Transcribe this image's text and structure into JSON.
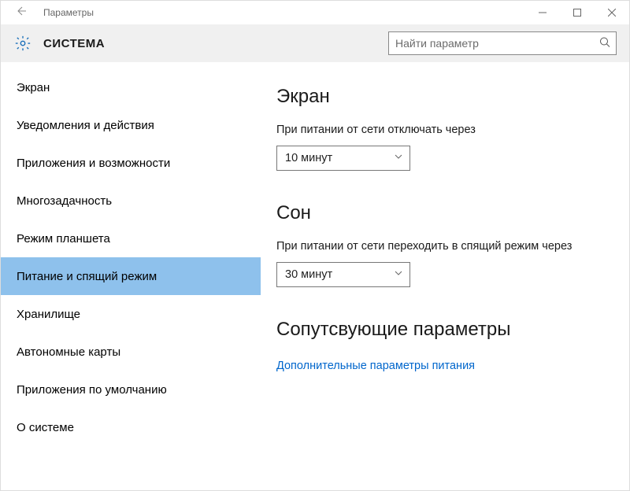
{
  "window": {
    "title": "Параметры"
  },
  "header": {
    "category": "СИСТЕМА",
    "search_placeholder": "Найти параметр"
  },
  "sidebar": {
    "items": [
      {
        "label": "Экран"
      },
      {
        "label": "Уведомления и действия"
      },
      {
        "label": "Приложения и возможности"
      },
      {
        "label": "Многозадачность"
      },
      {
        "label": "Режим планшета"
      },
      {
        "label": "Питание и спящий режим"
      },
      {
        "label": "Хранилище"
      },
      {
        "label": "Автономные карты"
      },
      {
        "label": "Приложения по умолчанию"
      },
      {
        "label": "О системе"
      }
    ],
    "selected_index": 5
  },
  "main": {
    "display": {
      "heading": "Экран",
      "turn_off_label": "При питании от сети отключать через",
      "turn_off_value": "10 минут"
    },
    "sleep": {
      "heading": "Сон",
      "sleep_label": "При питании от сети переходить в спящий режим через",
      "sleep_value": "30 минут"
    },
    "related": {
      "heading": "Сопутсвующие параметры",
      "link": "Дополнительные параметры питания"
    }
  }
}
